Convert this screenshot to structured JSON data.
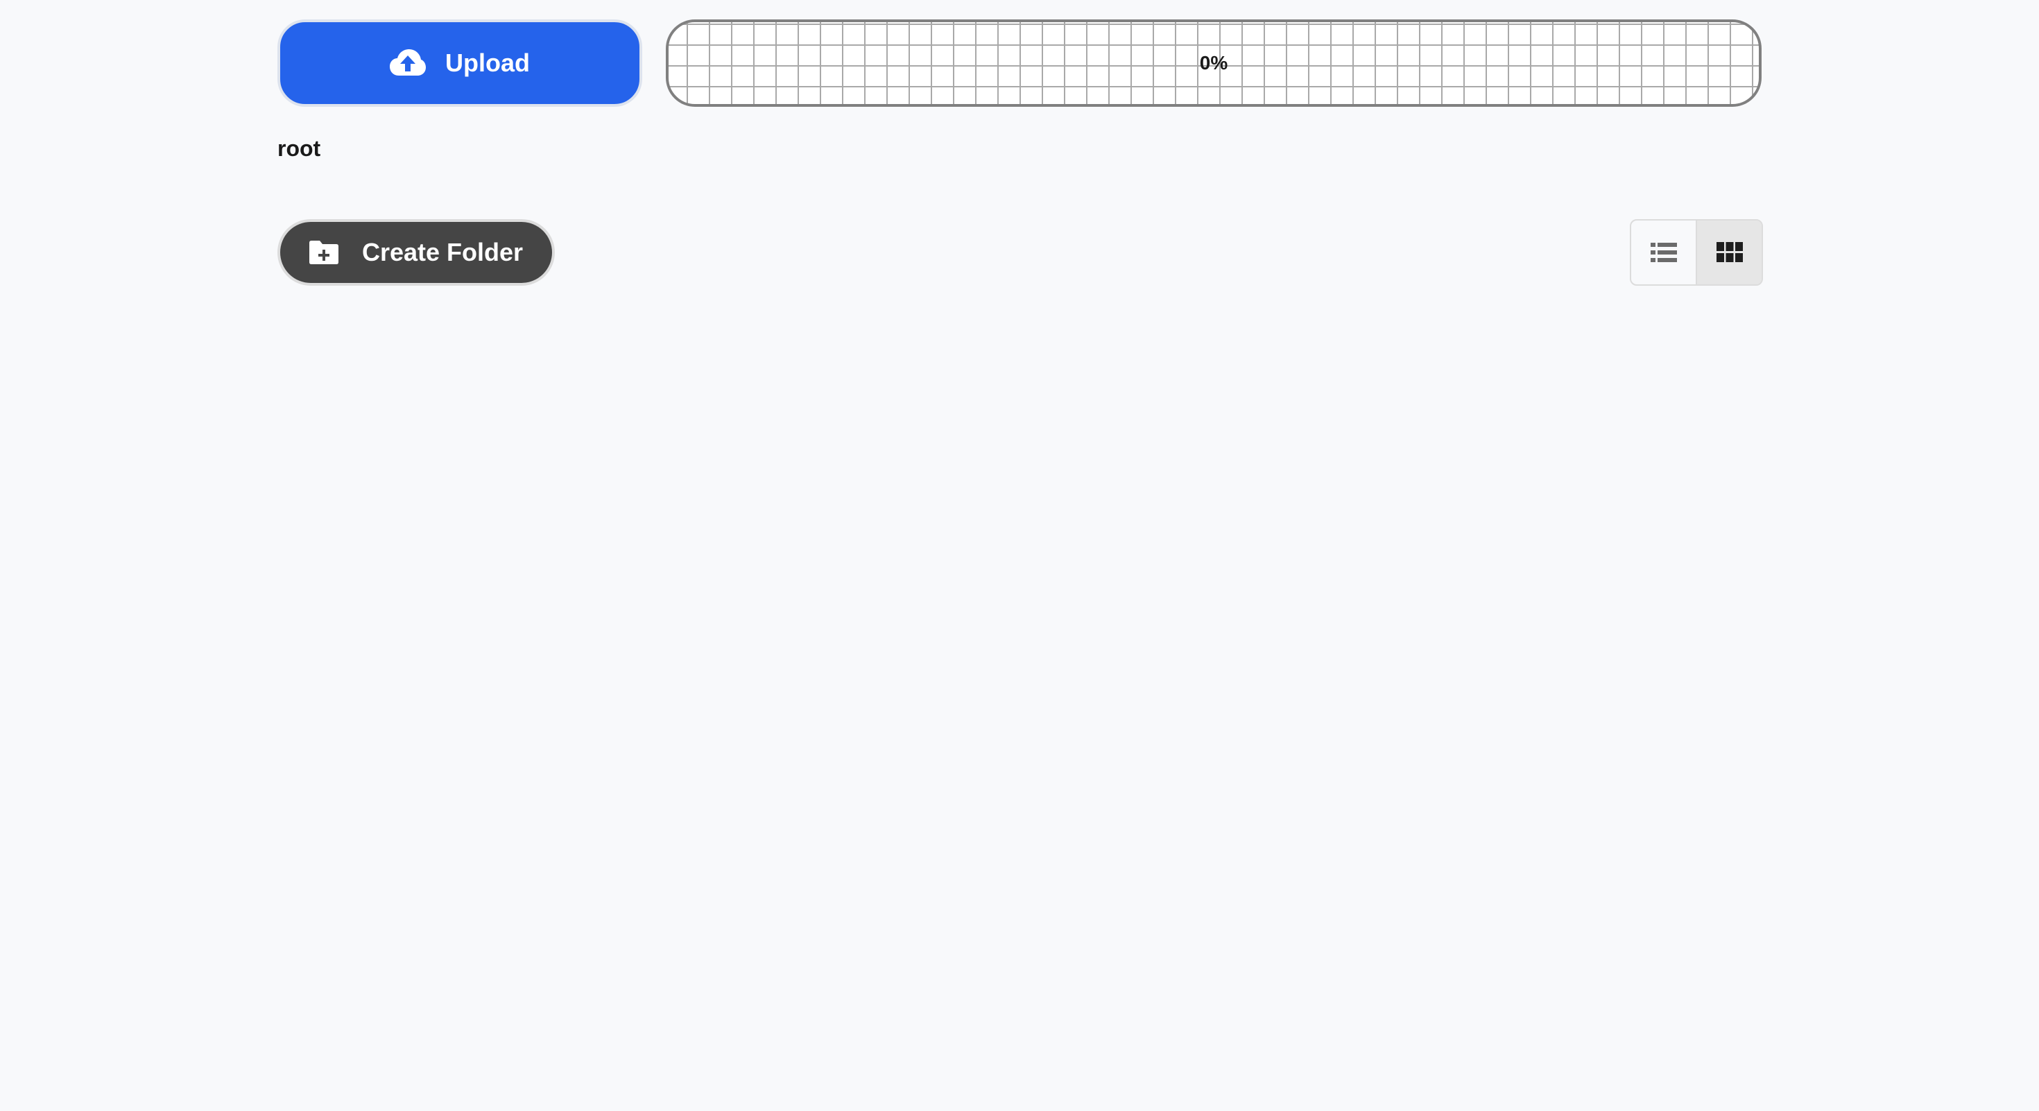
{
  "toolbar": {
    "upload_label": "Upload",
    "upload_icon": "cloud-upload-icon",
    "accent_color": "#2563eb"
  },
  "progress": {
    "value_percent": 0,
    "label": "0%"
  },
  "breadcrumb": {
    "current": "root"
  },
  "actions": {
    "create_folder_label": "Create Folder",
    "create_folder_icon": "folder-plus-icon",
    "button_color": "#454545"
  },
  "view_toggle": {
    "options": [
      {
        "icon": "list-view-icon",
        "active": false
      },
      {
        "icon": "grid-view-icon",
        "active": true
      }
    ]
  }
}
